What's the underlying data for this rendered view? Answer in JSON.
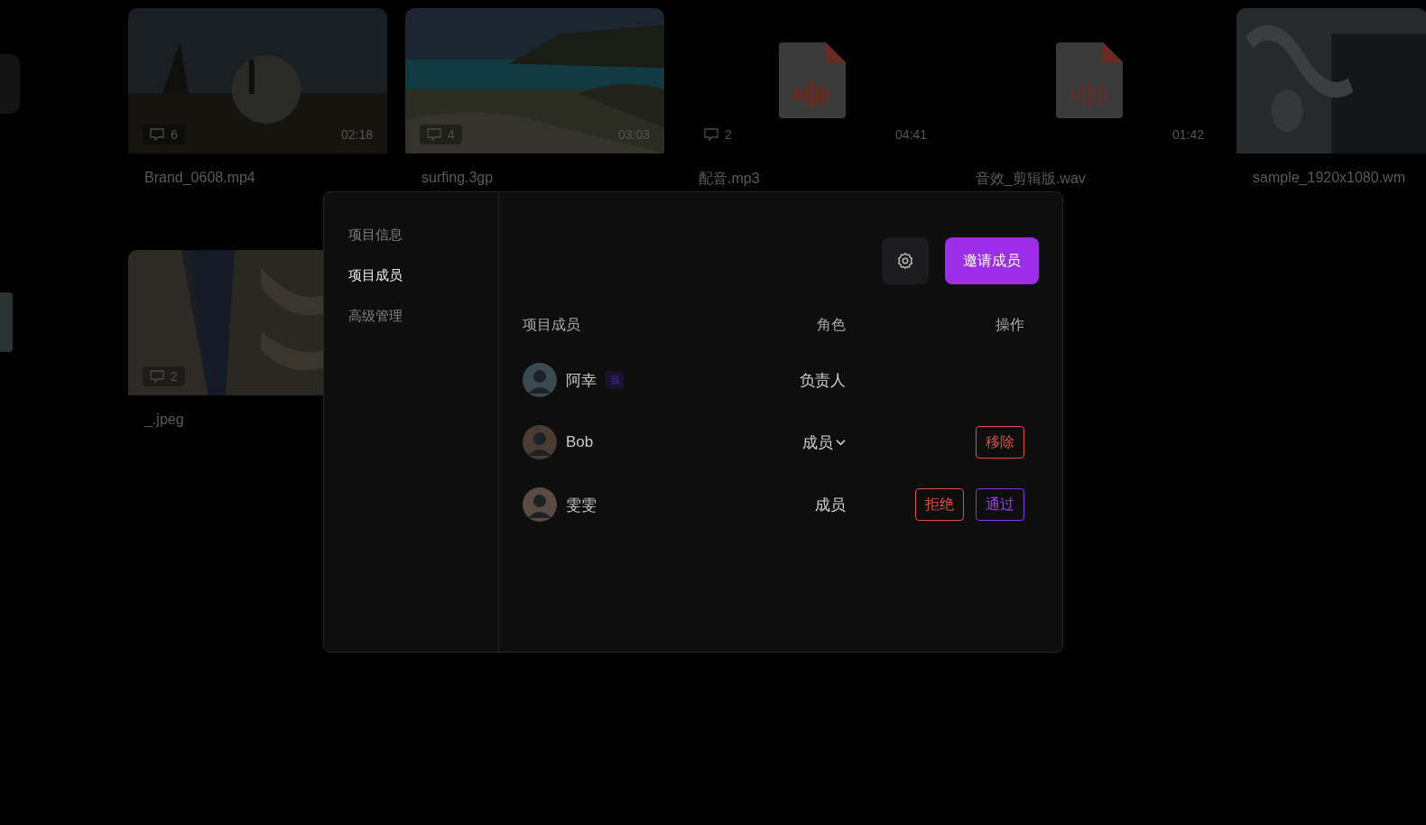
{
  "cards": [
    {
      "kind": "video",
      "comments": "6",
      "duration": "02:18",
      "name": "Brand_0608.mp4"
    },
    {
      "kind": "video",
      "comments": "4",
      "duration": "03:03",
      "name": "surfing.3gp"
    },
    {
      "kind": "audio",
      "comments": "2",
      "duration": "04:41",
      "name": "配音.mp3"
    },
    {
      "kind": "audio",
      "duration": "01:42",
      "name": "音效_剪辑版.wav"
    },
    {
      "kind": "video",
      "name": "sample_1920x1080.wm"
    }
  ],
  "cards_row2": [
    {
      "kind": "video",
      "comments": "2",
      "name": "_.jpeg"
    }
  ],
  "dialog": {
    "nav": [
      {
        "label": "项目信息",
        "selected": false
      },
      {
        "label": "项目成员",
        "selected": true
      },
      {
        "label": "高级管理",
        "selected": false
      }
    ],
    "invite_button": "邀请成员",
    "columns": [
      "项目成员",
      "角色",
      "操作"
    ],
    "members": [
      {
        "name": "阿幸",
        "badge": "我",
        "role": "负责人",
        "role_editable": false
      },
      {
        "name": "Bob",
        "role": "成员",
        "role_editable": true,
        "actions": [
          {
            "label": "移除",
            "kind": "danger"
          }
        ]
      },
      {
        "name": "雯雯",
        "role": "成员",
        "role_editable": false,
        "actions": [
          {
            "label": "拒绝",
            "kind": "danger"
          },
          {
            "label": "通过",
            "kind": "primary"
          }
        ]
      }
    ]
  }
}
